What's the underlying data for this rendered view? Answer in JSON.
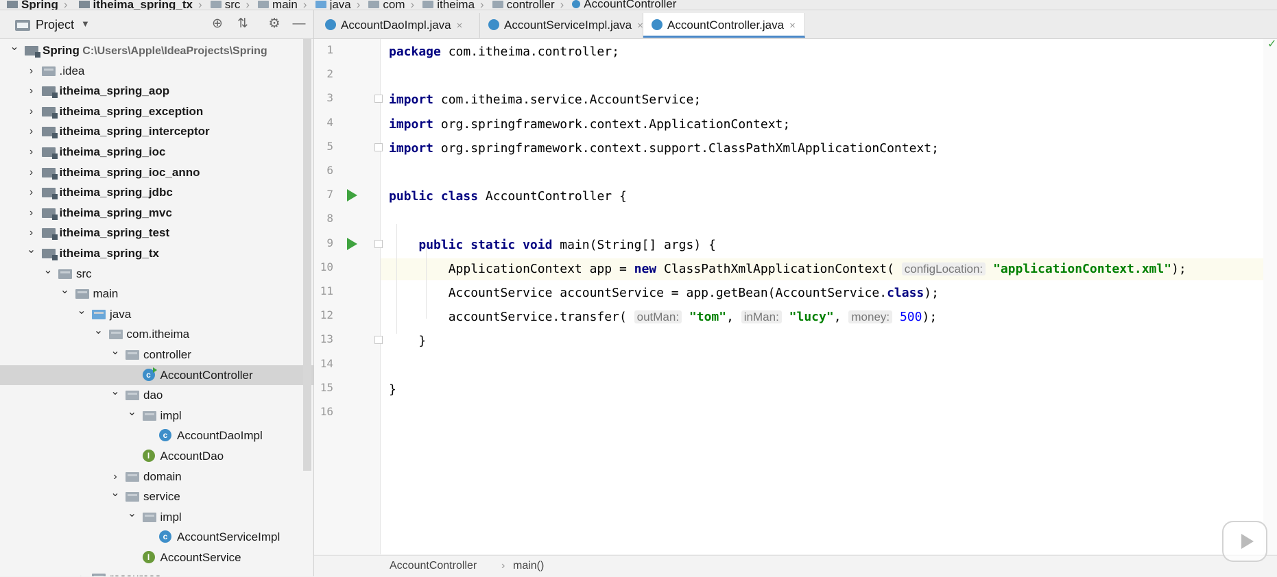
{
  "navbar": {
    "crumbs": [
      "Spring",
      "itheima_spring_tx",
      "src",
      "main",
      "java",
      "com",
      "itheima",
      "controller",
      "AccountController"
    ]
  },
  "project_panel": {
    "title": "Project",
    "dropdown": "▼",
    "icons": [
      "target-icon",
      "collapse-icon",
      "gear-icon",
      "minimize-icon"
    ],
    "tree": [
      {
        "label": "Spring",
        "path": "C:\\Users\\Apple\\IdeaProjects\\Spring",
        "icon": "module",
        "depth": 0,
        "expanded": true,
        "bold": true
      },
      {
        "label": ".idea",
        "icon": "folder",
        "depth": 1,
        "expanded": false,
        "bold": false
      },
      {
        "label": "itheima_spring_aop",
        "icon": "module",
        "depth": 1,
        "expanded": false,
        "bold": true
      },
      {
        "label": "itheima_spring_exception",
        "icon": "module",
        "depth": 1,
        "expanded": false,
        "bold": true
      },
      {
        "label": "itheima_spring_interceptor",
        "icon": "module",
        "depth": 1,
        "expanded": false,
        "bold": true
      },
      {
        "label": "itheima_spring_ioc",
        "icon": "module",
        "depth": 1,
        "expanded": false,
        "bold": true
      },
      {
        "label": "itheima_spring_ioc_anno",
        "icon": "module",
        "depth": 1,
        "expanded": false,
        "bold": true
      },
      {
        "label": "itheima_spring_jdbc",
        "icon": "module",
        "depth": 1,
        "expanded": false,
        "bold": true
      },
      {
        "label": "itheima_spring_mvc",
        "icon": "module",
        "depth": 1,
        "expanded": false,
        "bold": true
      },
      {
        "label": "itheima_spring_test",
        "icon": "module",
        "depth": 1,
        "expanded": false,
        "bold": true
      },
      {
        "label": "itheima_spring_tx",
        "icon": "module",
        "depth": 1,
        "expanded": true,
        "bold": true
      },
      {
        "label": "src",
        "icon": "folder",
        "depth": 2,
        "expanded": true,
        "bold": false
      },
      {
        "label": "main",
        "icon": "folder",
        "depth": 3,
        "expanded": true,
        "bold": false
      },
      {
        "label": "java",
        "icon": "folder-blue",
        "depth": 4,
        "expanded": true,
        "bold": false
      },
      {
        "label": "com.itheima",
        "icon": "package",
        "depth": 5,
        "expanded": true,
        "bold": false
      },
      {
        "label": "controller",
        "icon": "package",
        "depth": 6,
        "expanded": true,
        "bold": false
      },
      {
        "label": "AccountController",
        "icon": "class-run",
        "depth": 7,
        "expanded": null,
        "bold": false,
        "selected": true
      },
      {
        "label": "dao",
        "icon": "package",
        "depth": 6,
        "expanded": true,
        "bold": false
      },
      {
        "label": "impl",
        "icon": "package",
        "depth": 7,
        "expanded": true,
        "bold": false
      },
      {
        "label": "AccountDaoImpl",
        "icon": "class",
        "depth": 8,
        "expanded": null,
        "bold": false
      },
      {
        "label": "AccountDao",
        "icon": "interface",
        "depth": 7,
        "expanded": null,
        "bold": false
      },
      {
        "label": "domain",
        "icon": "package",
        "depth": 6,
        "expanded": false,
        "bold": false
      },
      {
        "label": "service",
        "icon": "package",
        "depth": 6,
        "expanded": true,
        "bold": false
      },
      {
        "label": "impl",
        "icon": "package",
        "depth": 7,
        "expanded": true,
        "bold": false
      },
      {
        "label": "AccountServiceImpl",
        "icon": "class",
        "depth": 8,
        "expanded": null,
        "bold": false
      },
      {
        "label": "AccountService",
        "icon": "interface",
        "depth": 7,
        "expanded": null,
        "bold": false
      },
      {
        "label": "resources",
        "icon": "folder",
        "depth": 4,
        "expanded": false,
        "bold": false
      }
    ]
  },
  "tabs": [
    {
      "label": "AccountDaoImpl.java",
      "active": false
    },
    {
      "label": "AccountServiceImpl.java",
      "active": false
    },
    {
      "label": "AccountController.java",
      "active": true
    }
  ],
  "editor": {
    "current_line": 10,
    "line_numbers": [
      "1",
      "2",
      "3",
      "4",
      "5",
      "6",
      "7",
      "8",
      "9",
      "10",
      "11",
      "12",
      "13",
      "14",
      "15",
      "16"
    ],
    "lines": [
      [
        [
          "kw",
          "package"
        ],
        [
          "t",
          " com.itheima.controller;"
        ]
      ],
      [],
      [
        [
          "kw",
          "import"
        ],
        [
          "t",
          " com.itheima.service.AccountService;"
        ]
      ],
      [
        [
          "kw",
          "import"
        ],
        [
          "t",
          " org.springframework.context.ApplicationContext;"
        ]
      ],
      [
        [
          "kw",
          "import"
        ],
        [
          "t",
          " org.springframework.context.support.ClassPathXmlApplicationContext;"
        ]
      ],
      [],
      [
        [
          "kw",
          "public class"
        ],
        [
          "t",
          " AccountController {"
        ]
      ],
      [],
      [
        [
          "t",
          "    "
        ],
        [
          "kw",
          "public static void"
        ],
        [
          "t",
          " main(String[] args) {"
        ]
      ],
      [
        [
          "t",
          "        ApplicationContext app = "
        ],
        [
          "kw",
          "new"
        ],
        [
          "t",
          " ClassPathXmlApplicationContext( "
        ],
        [
          "hint",
          "configLocation:"
        ],
        [
          "t",
          " "
        ],
        [
          "str",
          "\"applicationContext.xml\""
        ],
        [
          "t",
          ");"
        ]
      ],
      [
        [
          "t",
          "        AccountService accountService = app.getBean(AccountService."
        ],
        [
          "kw",
          "class"
        ],
        [
          "t",
          ");"
        ]
      ],
      [
        [
          "t",
          "        accountService.transfer( "
        ],
        [
          "hint",
          "outMan:"
        ],
        [
          "t",
          " "
        ],
        [
          "str",
          "\"tom\""
        ],
        [
          "t",
          ", "
        ],
        [
          "hint",
          "inMan:"
        ],
        [
          "t",
          " "
        ],
        [
          "str",
          "\"lucy\""
        ],
        [
          "t",
          ", "
        ],
        [
          "hint",
          "money:"
        ],
        [
          "t",
          " "
        ],
        [
          "num",
          "500"
        ],
        [
          "t",
          ");"
        ]
      ],
      [
        [
          "t",
          "    }"
        ]
      ],
      [],
      [
        [
          "t",
          "}"
        ]
      ],
      []
    ]
  },
  "breadcrumb": {
    "class": "AccountController",
    "separator": "›",
    "method": "main()"
  },
  "glyphs": {
    "arrow_expanded": "⌄",
    "arrow_collapsed": "›",
    "close": "×",
    "check": "✓",
    "target": "⊕",
    "collapse": "⇅",
    "gear": "⚙",
    "minimize": "—"
  }
}
